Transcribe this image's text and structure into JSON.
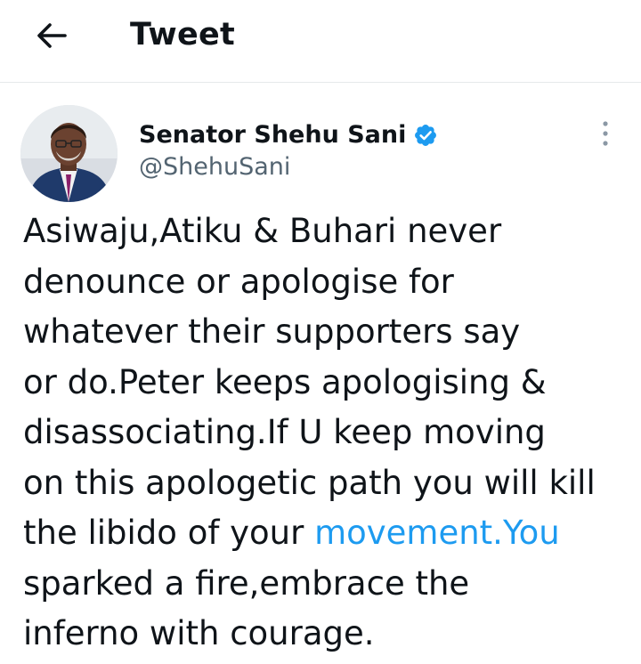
{
  "header": {
    "title": "Tweet"
  },
  "tweet": {
    "author": {
      "name": "Senator Shehu Sani",
      "handle": "@ShehuSani",
      "verified": true
    },
    "lines": {
      "l1": "Asiwaju,Atiku & Buhari never",
      "l2": "denounce or apologise for",
      "l3": "whatever their supporters say",
      "l4": "or do.Peter keeps apologising &",
      "l5": "disassociating.If U keep moving",
      "l6": "on this apologetic path you will kill",
      "l7_pre": "the libido of your ",
      "l7_link": "movement.You",
      "l8": "sparked a fire,embrace the",
      "l9": "inferno with courage."
    }
  },
  "colors": {
    "accent": "#1d9bf0",
    "text": "#0f1419",
    "secondary": "#536471",
    "divider": "#e6e9eb"
  },
  "icons": {
    "back": "arrow-left-icon",
    "verified": "verified-badge-icon",
    "more": "more-vertical-icon"
  }
}
